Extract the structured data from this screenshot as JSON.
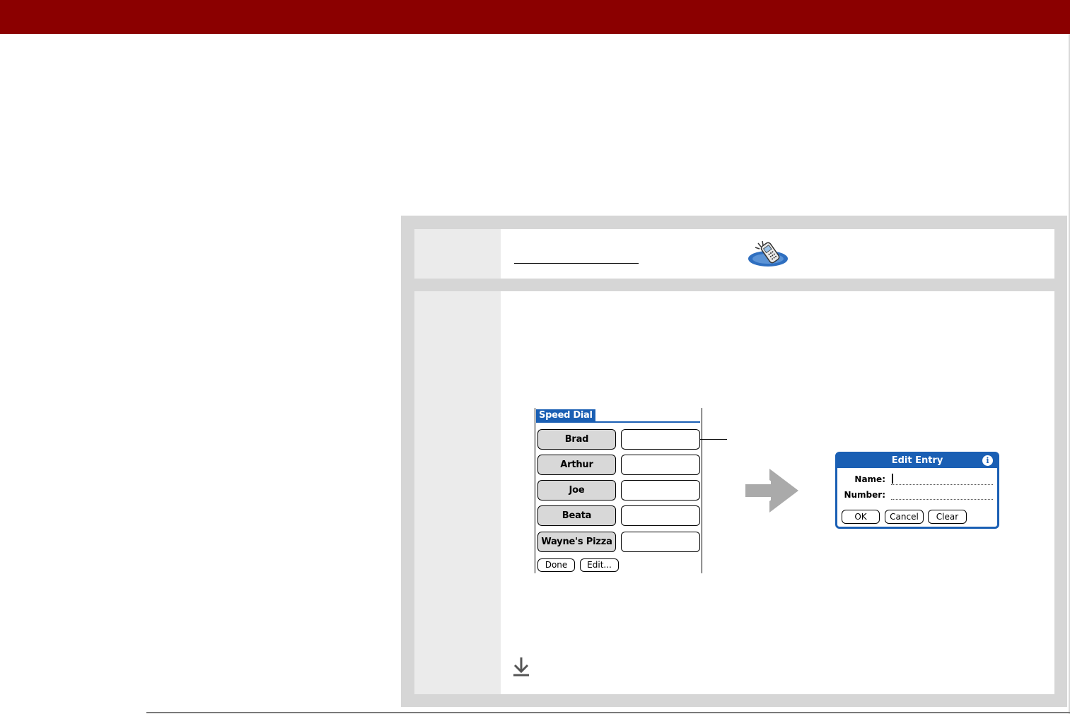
{
  "speed_dial": {
    "title": "Speed Dial",
    "entries": [
      "Brad",
      "Arthur",
      "Joe",
      "Beata",
      "Wayne's Pizza"
    ],
    "done_label": "Done",
    "edit_label": "Edit..."
  },
  "edit_entry": {
    "title": "Edit Entry",
    "info_glyph": "i",
    "name_label": "Name:",
    "number_label": "Number:",
    "ok_label": "OK",
    "cancel_label": "Cancel",
    "clear_label": "Clear"
  },
  "colors": {
    "header_bar": "#8b0000",
    "palm_blue": "#1a5fb4",
    "panel_gray": "#d6d6d6"
  },
  "icons": {
    "phone": "phone-icon",
    "arrow": "right-arrow-icon",
    "tip": "download-arrow-icon"
  }
}
